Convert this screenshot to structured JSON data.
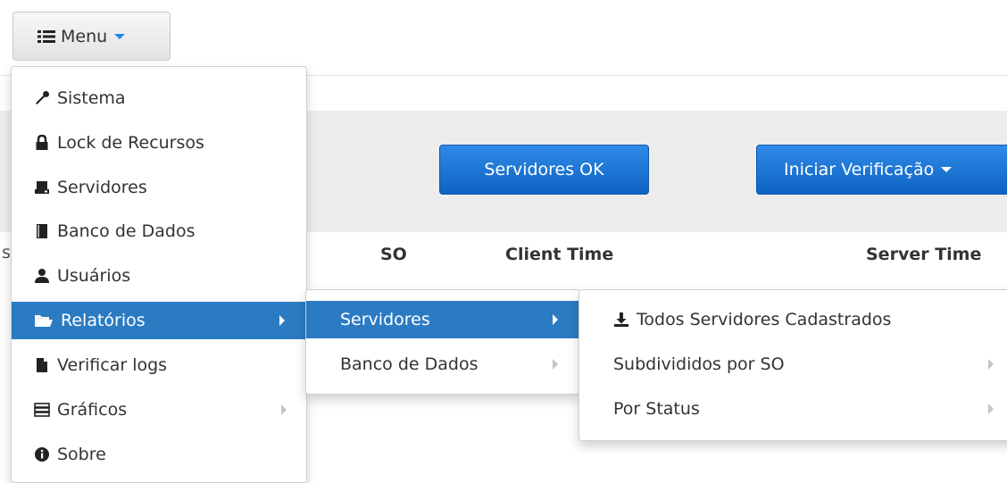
{
  "menu_button": {
    "label": "Menu"
  },
  "main_menu": {
    "items": [
      {
        "label": "Sistema",
        "icon": "wrench-icon"
      },
      {
        "label": "Lock de Recursos",
        "icon": "lock-icon"
      },
      {
        "label": "Servidores",
        "icon": "hdd-icon"
      },
      {
        "label": "Banco de Dados",
        "icon": "book-icon"
      },
      {
        "label": "Usuários",
        "icon": "user-icon"
      },
      {
        "label": "Relatórios",
        "icon": "folder-open-icon",
        "active": true,
        "has_submenu": true
      },
      {
        "label": "Verificar logs",
        "icon": "file-icon"
      },
      {
        "label": "Gráficos",
        "icon": "list-icon",
        "has_submenu": true
      },
      {
        "label": "Sobre",
        "icon": "info-icon"
      }
    ]
  },
  "relatorios_submenu": {
    "items": [
      {
        "label": "Servidores",
        "active": true,
        "has_submenu": true
      },
      {
        "label": "Banco de Dados",
        "has_submenu": true
      }
    ]
  },
  "servidores_submenu": {
    "items": [
      {
        "label": "Todos Servidores Cadastrados",
        "icon": "download-icon"
      },
      {
        "label": "Subdivididos por SO",
        "has_submenu": true
      },
      {
        "label": "Por Status",
        "has_submenu": true
      }
    ]
  },
  "toolbar": {
    "servidores_ok": "Servidores OK",
    "iniciar_verificacao": "Iniciar Verificação"
  },
  "table": {
    "headers": [
      "SO",
      "Client Time",
      "Server Time"
    ],
    "stray_char": "s"
  },
  "colors": {
    "active_item": "#2b7bc3",
    "primary_button": "#1a73d6",
    "caret": "#1e88e5"
  }
}
